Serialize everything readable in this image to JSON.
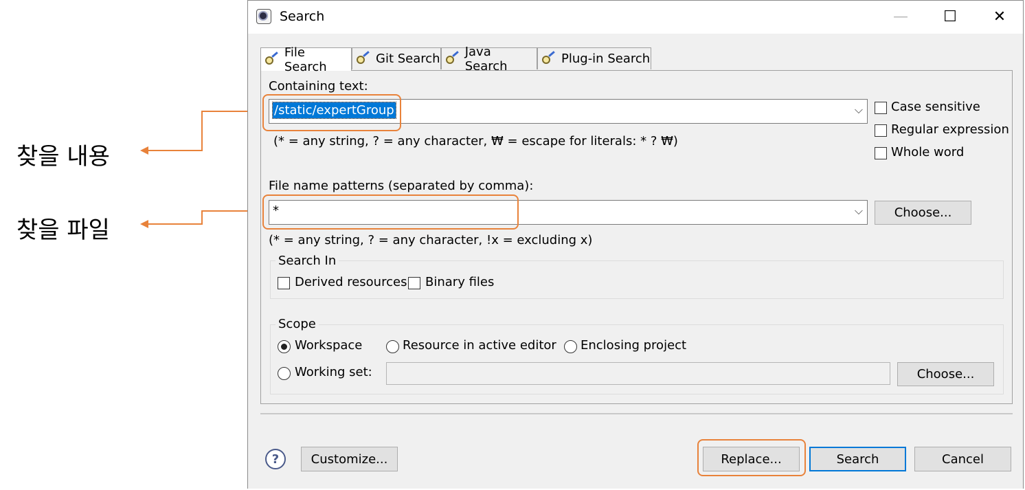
{
  "annotations": {
    "content_label": "찾을 내용",
    "file_label": "찾을 파일",
    "accent_color": "#e8823a"
  },
  "window": {
    "title": "Search",
    "icon": "eclipse-icon",
    "controls": {
      "minimize": "—",
      "maximize": "☐",
      "close": "✕"
    }
  },
  "tabs": [
    {
      "label": "File Search",
      "icon": "file-search-icon",
      "active": true
    },
    {
      "label": "Git Search",
      "icon": "git-search-icon",
      "active": false
    },
    {
      "label": "Java Search",
      "icon": "java-search-icon",
      "active": false
    },
    {
      "label": "Plug-in Search",
      "icon": "plugin-search-icon",
      "active": false
    }
  ],
  "containing": {
    "label": "Containing text:",
    "value": "/static/expertGroup",
    "hint": "(* = any string, ? = any character, ₩ = escape for literals: * ? ₩)"
  },
  "options": {
    "case_sensitive": "Case sensitive",
    "regular_expression": "Regular expression",
    "whole_word": "Whole word"
  },
  "file_patterns": {
    "label": "File name patterns (separated by comma):",
    "value": "*",
    "hint": "(* = any string, ? = any character, !x = excluding x)",
    "choose_label": "Choose..."
  },
  "search_in": {
    "title": "Search In",
    "derived": "Derived resources",
    "binary": "Binary files"
  },
  "scope": {
    "title": "Scope",
    "workspace": "Workspace",
    "active_editor": "Resource in active editor",
    "enclosing_project": "Enclosing project",
    "working_set": "Working set:",
    "working_set_value": "",
    "choose_label": "Choose...",
    "selected": "Workspace"
  },
  "footer": {
    "help": "?",
    "customize": "Customize...",
    "replace": "Replace...",
    "search": "Search",
    "cancel": "Cancel"
  }
}
